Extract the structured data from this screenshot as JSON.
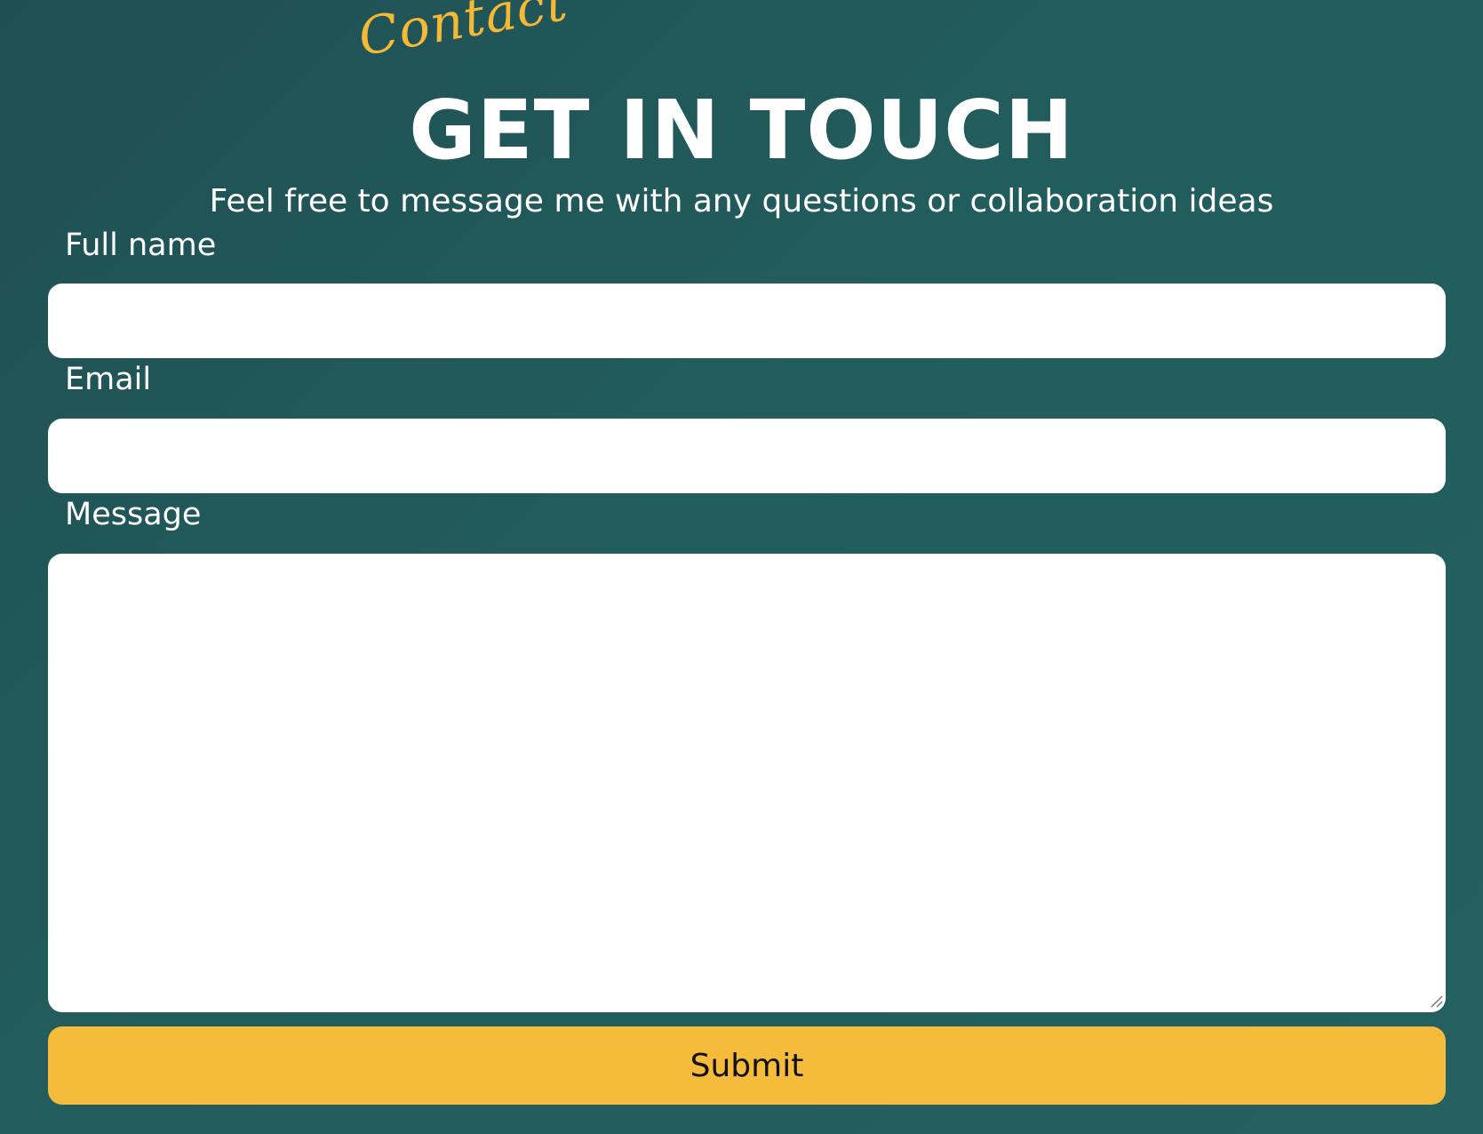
{
  "header": {
    "script_tag": "Contact",
    "title": "GET IN TOUCH",
    "subtitle": "Feel free to message me with any questions or collaboration ideas"
  },
  "form": {
    "full_name": {
      "label": "Full name",
      "value": "",
      "placeholder": ""
    },
    "email": {
      "label": "Email",
      "value": "",
      "placeholder": ""
    },
    "message": {
      "label": "Message",
      "value": "",
      "placeholder": ""
    },
    "submit_label": "Submit"
  },
  "colors": {
    "background": "#225a5a",
    "accent": "#f5bb3a",
    "text": "#ffffff",
    "input_background": "#ffffff"
  },
  "icons": {
    "resize_grip": "resize-handle-icon"
  }
}
